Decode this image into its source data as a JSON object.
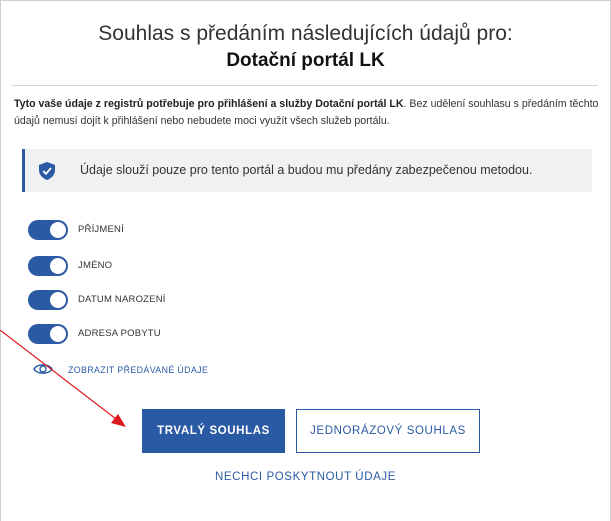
{
  "header": {
    "title": "Souhlas s předáním následujících údajů pro:",
    "portal_name": "Dotační portál LK"
  },
  "description": {
    "bold_part": "Tyto vaše údaje z registrů potřebuje pro přihlášení a služby Dotační portál LK",
    "rest": ". Bez udělení souhlasu s předáním těchto údajů nemusí dojít k přihlášení nebo nebudete moci využít všech služeb portálu."
  },
  "notice": {
    "icon": "shield-check-icon",
    "text": "Údaje slouží pouze pro tento portál a budou mu předány zabezpečenou metodou."
  },
  "fields": [
    {
      "label": "PŘÍJMENÍ",
      "enabled": true
    },
    {
      "label": "JMÉNO",
      "enabled": true
    },
    {
      "label": "DATUM NAROZENÍ",
      "enabled": true
    },
    {
      "label": "ADRESA POBYTU",
      "enabled": true
    }
  ],
  "show_data": {
    "icon": "eye-icon",
    "label": "ZOBRAZIT PŘEDÁVANÉ ÚDAJE"
  },
  "actions": {
    "permanent_label": "TRVALÝ SOUHLAS",
    "one_time_label": "JEDNORÁZOVÝ SOUHLAS",
    "decline_label": "NECHCI POSKYTNOUT ÚDAJE"
  },
  "colors": {
    "accent": "#2a5aa3",
    "annotation_arrow": "#e0191e",
    "notice_bg": "#f0f1f3"
  }
}
